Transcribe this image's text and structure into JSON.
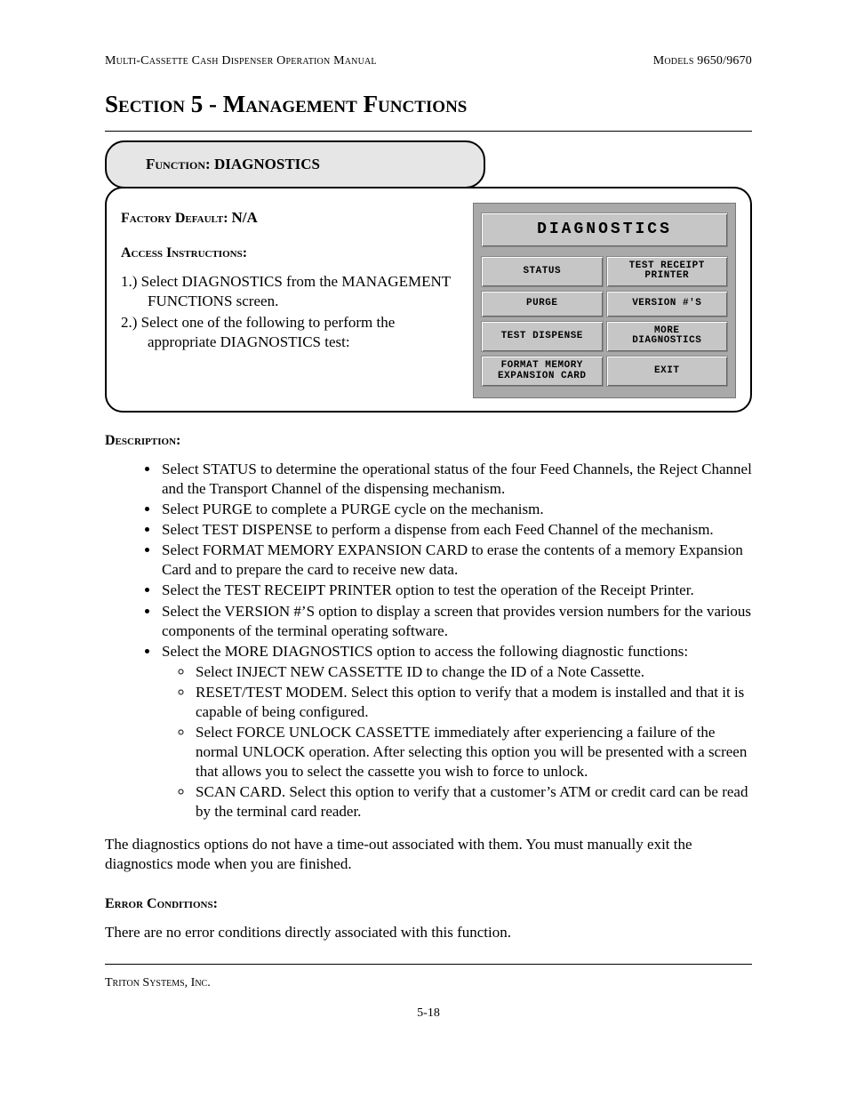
{
  "header": {
    "left": "Multi-Cassette Cash Dispenser Operation Manual",
    "right": "Models 9650/9670"
  },
  "section_title": "Section 5 - Management Functions",
  "function": {
    "label_prefix": "Function:  ",
    "name": "DIAGNOSTICS"
  },
  "factory_default": {
    "label": "Factory Default: ",
    "value": "N/A"
  },
  "access": {
    "label": "Access Instructions:",
    "steps": [
      "1.) Select DIAGNOSTICS from the MANAGEMENT FUNCTIONS screen.",
      "2.) Select one of the following to perform the appropriate DIAGNOSTICS test:"
    ]
  },
  "atm_screen": {
    "title": "DIAGNOSTICS",
    "buttons_left": [
      "STATUS",
      "PURGE",
      "TEST DISPENSE",
      "FORMAT MEMORY\nEXPANSION CARD"
    ],
    "buttons_right": [
      "TEST RECEIPT\nPRINTER",
      "VERSION #'S",
      "MORE\nDIAGNOSTICS",
      "EXIT"
    ]
  },
  "description": {
    "label": "Description:",
    "bullets": [
      "Select STATUS to determine the operational status of the four Feed Channels, the Reject Channel and the Transport Channel of the dispensing mechanism.",
      "Select PURGE to complete a PURGE cycle on the mechanism.",
      "Select TEST DISPENSE to perform a dispense from each Feed Channel of the mechanism.",
      "Select FORMAT MEMORY EXPANSION CARD to erase the contents of a memory Expansion Card and to prepare the card to receive new data.",
      "Select the TEST RECEIPT PRINTER option to test the operation of the Receipt Printer.",
      "Select the VERSION #’S option to display a screen that provides version numbers for the various components of the terminal operating software.",
      "Select the MORE DIAGNOSTICS option to access the following diagnostic functions:"
    ],
    "sub_bullets": [
      "Select INJECT NEW CASSETTE ID to change the ID of a Note Cassette.",
      "RESET/TEST MODEM. Select this option to verify that a modem is installed and that it is capable of being configured.",
      "Select FORCE UNLOCK CASSETTE immediately after experiencing a failure of the normal UNLOCK operation. After selecting this option you will be presented with a screen that allows you to select the cassette you wish to force to unlock.",
      "SCAN CARD. Select this option to verify that a customer’s ATM or credit card can be read by the terminal card reader."
    ],
    "closing": "The diagnostics options do not have a time-out associated with them.  You must manually exit the diagnostics mode when you are finished."
  },
  "errors": {
    "label": "Error Conditions:",
    "text": "There are no error conditions directly associated with this function."
  },
  "footer": {
    "company": "Triton Systems, Inc.",
    "page": "5-18"
  }
}
